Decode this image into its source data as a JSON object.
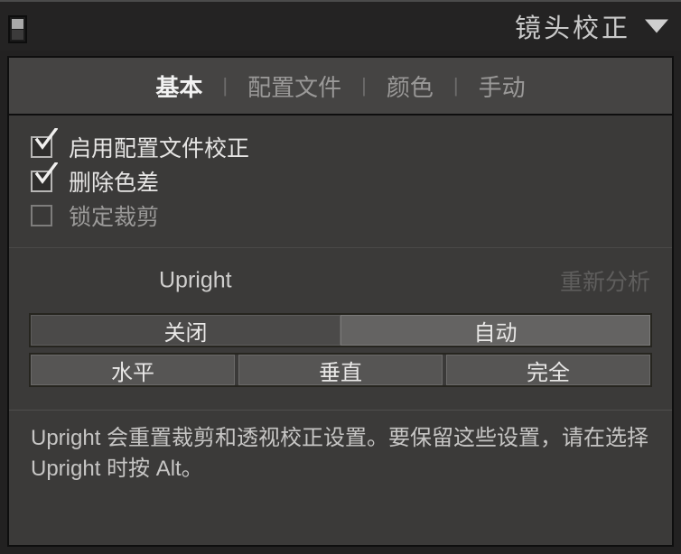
{
  "header": {
    "title": "镜头校正",
    "collapse_icon": "triangle-down-icon",
    "panel_switch_icon": "panel-toggle-icon"
  },
  "tabs": {
    "separator": "|",
    "items": [
      {
        "label": "基本",
        "active": true
      },
      {
        "label": "配置文件",
        "active": false
      },
      {
        "label": "颜色",
        "active": false
      },
      {
        "label": "手动",
        "active": false
      }
    ]
  },
  "checkboxes": [
    {
      "label": "启用配置文件校正",
      "checked": true,
      "enabled": true
    },
    {
      "label": "删除色差",
      "checked": true,
      "enabled": true
    },
    {
      "label": "锁定裁剪",
      "checked": false,
      "enabled": false
    }
  ],
  "upright": {
    "title": "Upright",
    "reanalyze_label": "重新分析",
    "reanalyze_enabled": false,
    "modes_primary": [
      {
        "label": "关闭",
        "selected": false
      },
      {
        "label": "自动",
        "selected": true
      }
    ],
    "modes_secondary": [
      {
        "label": "水平",
        "selected": false
      },
      {
        "label": "垂直",
        "selected": false
      },
      {
        "label": "完全",
        "selected": false
      }
    ]
  },
  "description": {
    "line1": "Upright 会重置裁剪和透视校正设置。要保留这些设置，请在选择",
    "line2": "Upright 时按 Alt。"
  },
  "colors": {
    "window_bg": "#222121",
    "header_bg": "#242323",
    "panel_bg": "#3b3a39",
    "tabs_bg": "#454443",
    "text_primary": "#e6e5e4",
    "text_dim": "#9a9998",
    "text_disabled": "#5f5e5d",
    "button_bg": "#4b4a49",
    "button_selected_bg": "#646362"
  }
}
